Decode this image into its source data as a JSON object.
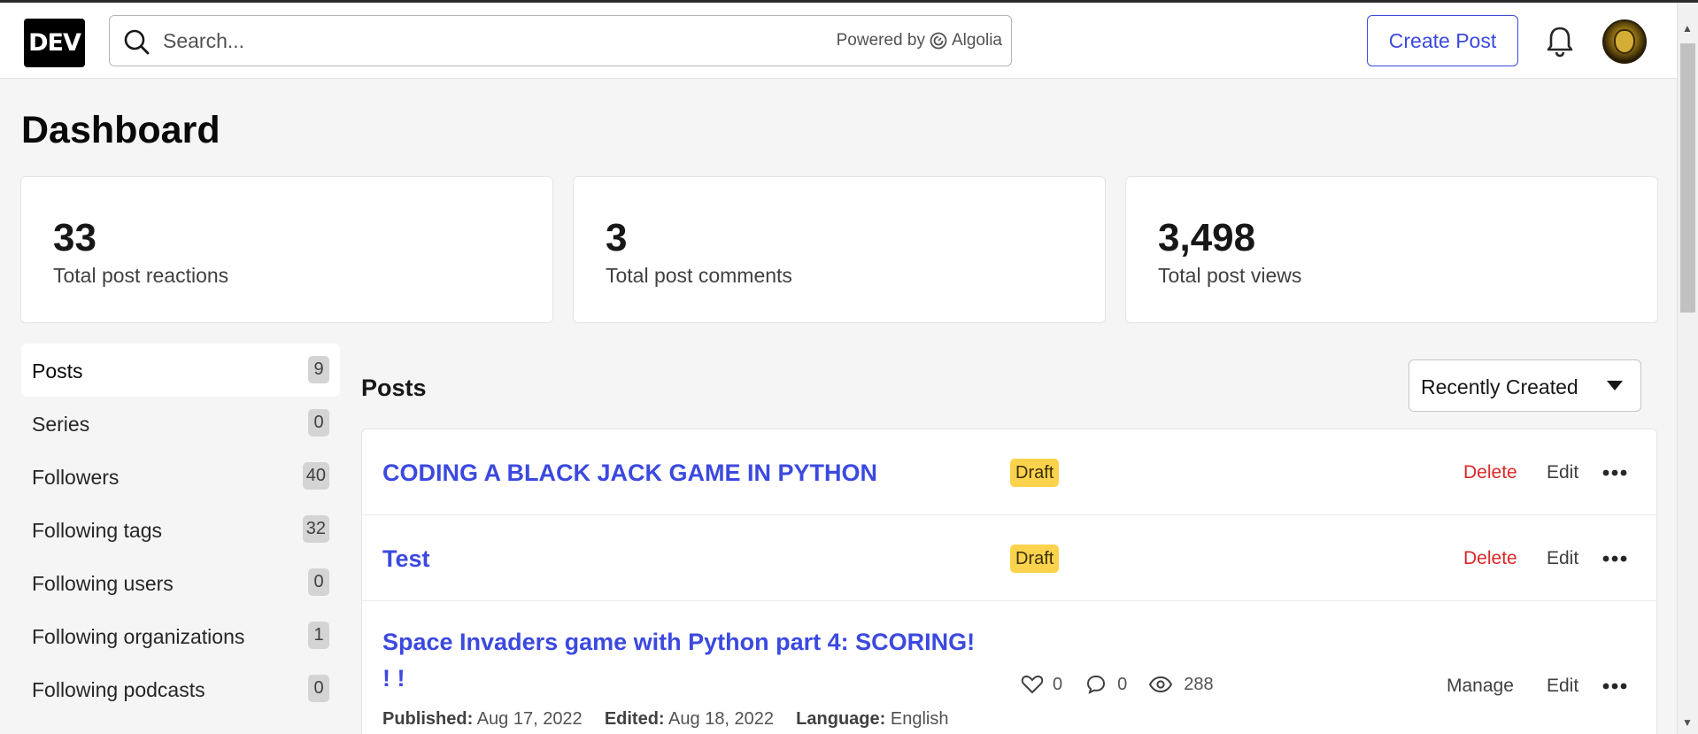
{
  "header": {
    "logo_text": "DEV",
    "search": {
      "placeholder": "Search...",
      "powered_by_label": "Powered by",
      "powered_by_brand": "Algolia"
    },
    "create_post_label": "Create Post",
    "notification_icon": "bell-icon",
    "avatar_icon": "user-avatar"
  },
  "page": {
    "title": "Dashboard"
  },
  "stats": [
    {
      "value": "33",
      "label": "Total post reactions"
    },
    {
      "value": "3",
      "label": "Total post comments"
    },
    {
      "value": "3,498",
      "label": "Total post views"
    }
  ],
  "sidebar": {
    "items": [
      {
        "label": "Posts",
        "count": "9",
        "active": true
      },
      {
        "label": "Series",
        "count": "0"
      },
      {
        "label": "Followers",
        "count": "40"
      },
      {
        "label": "Following tags",
        "count": "32"
      },
      {
        "label": "Following users",
        "count": "0"
      },
      {
        "label": "Following organizations",
        "count": "1"
      },
      {
        "label": "Following podcasts",
        "count": "0"
      }
    ]
  },
  "posts": {
    "heading": "Posts",
    "sort": {
      "selected": "Recently Created"
    },
    "items": [
      {
        "title": "CODING A BLACK JACK GAME IN PYTHON",
        "badge": "Draft",
        "delete_label": "Delete",
        "edit_label": "Edit"
      },
      {
        "title": "Test",
        "badge": "Draft",
        "delete_label": "Delete",
        "edit_label": "Edit"
      },
      {
        "title_line1": "Space Invaders game with Python part 4: SCORING!",
        "title_line2": "! !",
        "reactions": "0",
        "comments": "0",
        "views": "288",
        "manage_label": "Manage",
        "edit_label": "Edit",
        "published_label": "Published:",
        "published_date": "Aug 17, 2022",
        "edited_label": "Edited:",
        "edited_date": "Aug 18, 2022",
        "language_label": "Language:",
        "language": "English"
      }
    ]
  },
  "colors": {
    "accent": "#3b49df",
    "danger": "#dc2626",
    "draft": "#fcd34d",
    "background": "#f5f5f5"
  }
}
